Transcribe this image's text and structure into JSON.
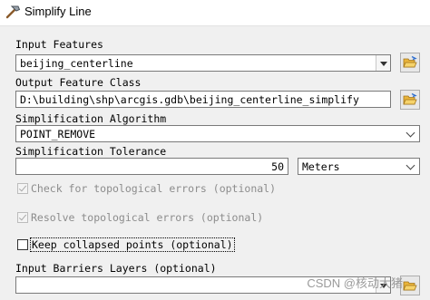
{
  "window": {
    "title": "Simplify Line"
  },
  "input_features": {
    "label": "Input Features",
    "value": "beijing_centerline"
  },
  "output_feature_class": {
    "label": "Output Feature Class",
    "value": "D:\\building\\shp\\arcgis.gdb\\beijing_centerline_simplify"
  },
  "simplification_algorithm": {
    "label": "Simplification Algorithm",
    "value": "POINT_REMOVE"
  },
  "simplification_tolerance": {
    "label": "Simplification Tolerance",
    "value": "50",
    "unit": "Meters"
  },
  "checks": {
    "topological": {
      "label": "Check for topological errors (optional)",
      "checked": true,
      "enabled": false
    },
    "resolve": {
      "label": "Resolve topological errors (optional)",
      "checked": true,
      "enabled": false
    },
    "keep_collapsed": {
      "label": "Keep collapsed points (optional)",
      "checked": false,
      "enabled": true
    }
  },
  "input_barriers": {
    "label": "Input Barriers Layers (optional)"
  },
  "watermark": "CSDN @核动大猪",
  "icons": {
    "title": "hammer-icon",
    "browse": "open-folder-icon"
  }
}
